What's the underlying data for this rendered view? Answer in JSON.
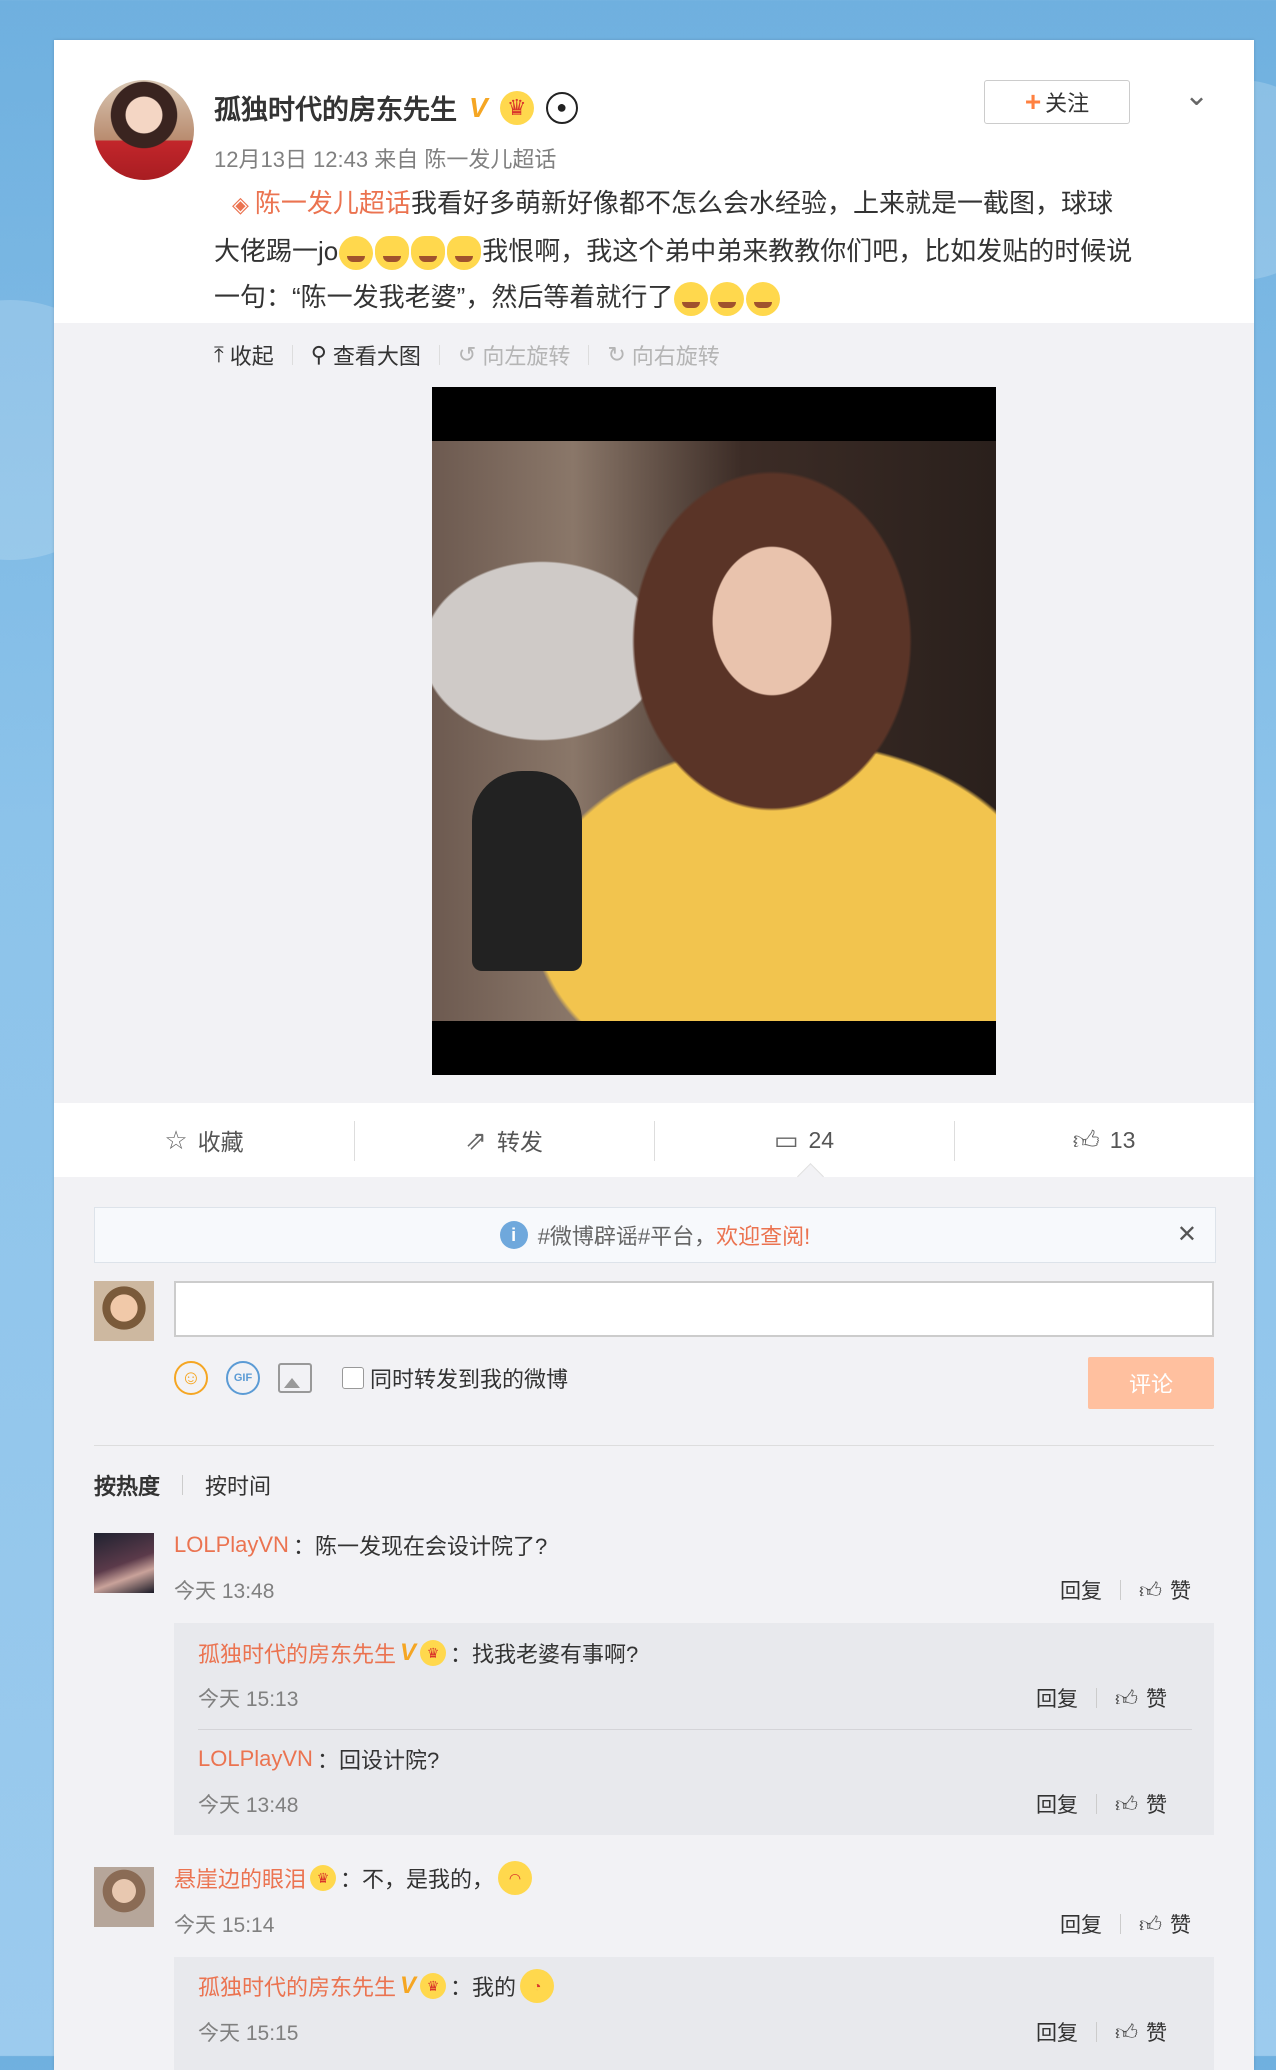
{
  "post": {
    "author_name": "孤独时代的房东先生",
    "verified_mark": "V",
    "meta": "12月13日 12:43 来自 陈一发儿超话",
    "follow_label": "关注",
    "topic_link": "陈一发儿超话",
    "text_line1": "我看好多萌新好像都不怎么会水经验，上来就是一截图，球球",
    "text_line2_a": "大佬踢一jo",
    "text_line2_b": "我恨啊，我这个弟中弟来教教你们吧，比如发贴的时候说",
    "text_line3": "一句：“陈一发我老婆”，然后等着就行了"
  },
  "media_tools": {
    "collapse": "收起",
    "view_large": "查看大图",
    "rotate_left": "向左旋转",
    "rotate_right": "向右旋转"
  },
  "actions": {
    "favorite": "收藏",
    "repost": "转发",
    "comments": "24",
    "likes": "13"
  },
  "notice": {
    "text": "#微博辟谣#平台，",
    "highlight": "欢迎查阅!"
  },
  "composer": {
    "repost_checkbox_label": "同时转发到我的微博",
    "submit_label": "评论"
  },
  "sort": {
    "hot": "按热度",
    "time": "按时间"
  },
  "labels": {
    "reply": "回复",
    "like": "赞"
  },
  "comments": [
    {
      "user": "LOLPlayVN",
      "text": "：陈一发现在会设计院了?",
      "time": "今天 13:48",
      "replies": [
        {
          "user": "孤独时代的房东先生",
          "text": "：找我老婆有事啊?",
          "time": "今天 15:13"
        },
        {
          "user": "LOLPlayVN",
          "text": "：回设计院?",
          "time": "今天 13:48"
        }
      ]
    },
    {
      "user": "悬崖边的眼泪",
      "text": "：不，是我的，",
      "time": "今天 15:14",
      "replies": [
        {
          "user": "孤独时代的房东先生",
          "text": "：我的",
          "time": "今天 15:15"
        }
      ]
    }
  ],
  "colors": {
    "link_orange": "#eb7350",
    "verified_gold": "#f5a623",
    "submit_disabled": "#ffc09f"
  }
}
